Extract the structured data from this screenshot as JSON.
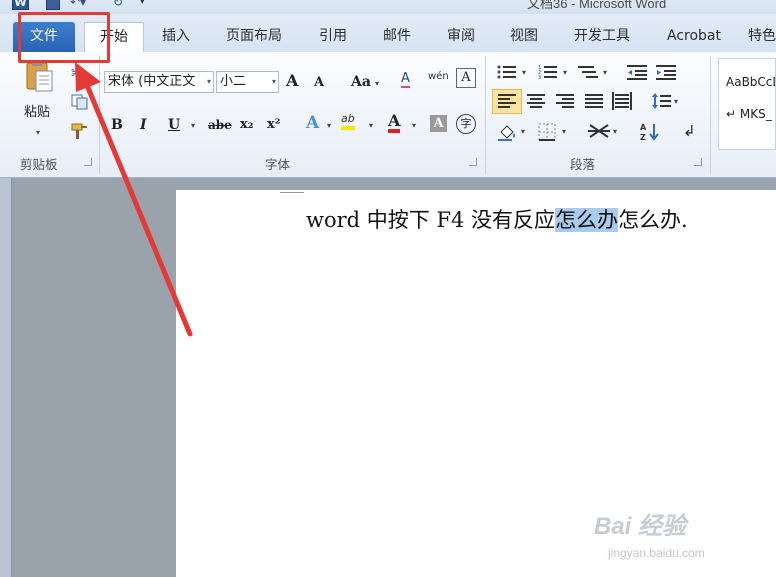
{
  "titlebar": {
    "app_icon_label": "W",
    "title": "文档36 - Microsoft Word"
  },
  "tabs": {
    "file": "文件",
    "items": [
      "开始",
      "插入",
      "页面布局",
      "引用",
      "邮件",
      "审阅",
      "视图",
      "开发工具",
      "Acrobat",
      "特色"
    ],
    "active": "开始"
  },
  "ribbon": {
    "clipboard": {
      "paste_label": "粘贴",
      "group_label": "剪贴板"
    },
    "font": {
      "font_name": "宋体 (中文正文",
      "font_size": "小二",
      "grow_label": "A",
      "shrink_label": "A",
      "case_label": "Aa",
      "clear_label": "A",
      "phonetic_label": "wén",
      "border_char_label": "A",
      "bold": "B",
      "italic": "I",
      "underline": "U",
      "strike": "abe",
      "subscript": "x₂",
      "superscript": "x²",
      "text_effect": "A",
      "highlight": "ab",
      "font_color": "A",
      "char_shading": "A",
      "enclose_char": "字",
      "group_label": "字体"
    },
    "paragraph": {
      "group_label": "段落"
    },
    "styles": {
      "sample": "AaBbCcD",
      "item": "↵ MKS_"
    }
  },
  "document": {
    "text_before": "word 中按下 F4 没有反应",
    "text_selected": "怎么办",
    "text_after": "怎么办."
  },
  "colors": {
    "file_tab": "#2a62b4",
    "annotation_red": "#e53935",
    "selection": "#a8cbee"
  },
  "watermark": {
    "brand": "Bai 经验",
    "url": "jingyan.baidu.com"
  }
}
